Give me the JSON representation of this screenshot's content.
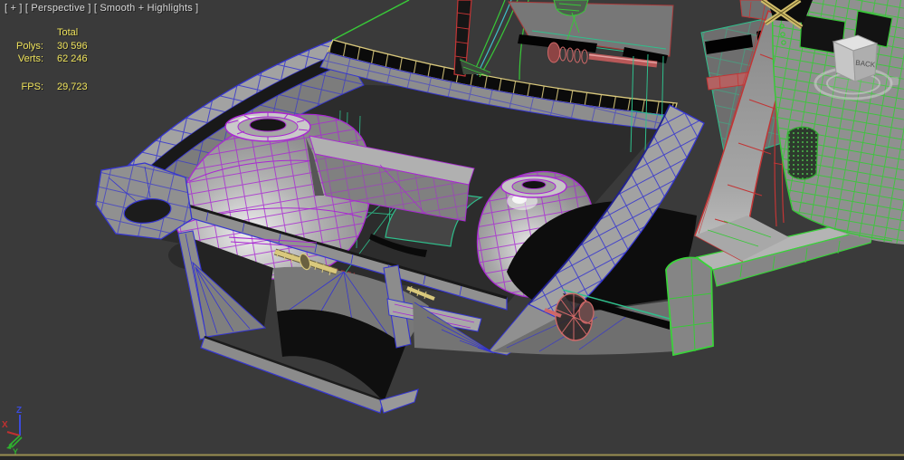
{
  "viewport": {
    "label": "[ + ] [ Perspective ] [ Smooth + Highlights ]",
    "stats": {
      "total_label": "Total",
      "polys_label": "Polys:",
      "polys_value": "30 596",
      "verts_label": "Verts:",
      "verts_value": "62 246",
      "fps_label": "FPS:",
      "fps_value": "29,723"
    },
    "axis_gizmo": {
      "x_label": "X",
      "y_label": "Y",
      "z_label": "Z"
    },
    "viewcube": {
      "visible_face_label": "BACK"
    },
    "colors": {
      "background": "#3a3a3a",
      "viewport_border": "#9a8f52",
      "label_text": "#d9d9d9",
      "stats_text": "#efe35c",
      "wire_blue": "#3535cf",
      "wire_purple": "#a928d2",
      "wire_teal": "#2fbf8c",
      "wire_green": "#38c838",
      "wire_red": "#c23535",
      "wire_pink": "#d06868",
      "wire_yellow": "#d9c87c",
      "axis_x": "#c03030",
      "axis_y": "#2fb02f",
      "axis_z": "#3b4bdc"
    }
  }
}
